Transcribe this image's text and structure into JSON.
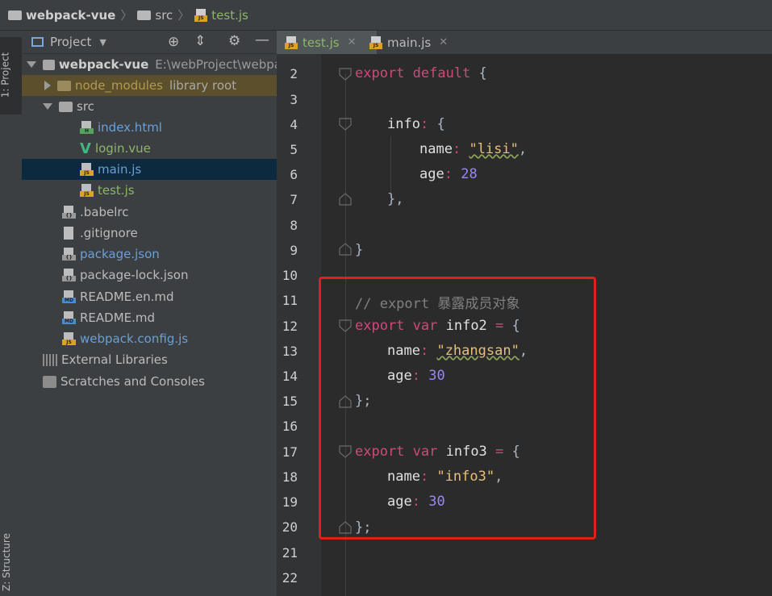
{
  "breadcrumb": {
    "project": "webpack-vue",
    "folder": "src",
    "file": "test.js"
  },
  "sidebar_tabs": {
    "project": "1: Project",
    "structure": "Z: Structure"
  },
  "project_panel": {
    "title": "Project",
    "tree": [
      {
        "label": "webpack-vue",
        "hint": "E:\\webProject\\webpa"
      },
      {
        "label": "node_modules",
        "hint": "library root"
      },
      {
        "label": "src"
      },
      {
        "label": "index.html"
      },
      {
        "label": "login.vue"
      },
      {
        "label": "main.js"
      },
      {
        "label": "test.js"
      },
      {
        "label": ".babelrc"
      },
      {
        "label": ".gitignore"
      },
      {
        "label": "package.json"
      },
      {
        "label": "package-lock.json"
      },
      {
        "label": "README.en.md"
      },
      {
        "label": "README.md"
      },
      {
        "label": "webpack.config.js"
      },
      {
        "label": "External Libraries"
      },
      {
        "label": "Scratches and Consoles"
      }
    ]
  },
  "editor_tabs": [
    {
      "label": "test.js",
      "active": true
    },
    {
      "label": "main.js",
      "active": false
    }
  ],
  "code": {
    "line_numbers": [
      "2",
      "3",
      "4",
      "5",
      "6",
      "7",
      "8",
      "9",
      "10",
      "11",
      "12",
      "13",
      "14",
      "15",
      "16",
      "17",
      "18",
      "19",
      "20",
      "21",
      "22"
    ],
    "export_default": "export default",
    "info_key": "info",
    "name_key": "name",
    "age_key": "age",
    "lisi": "\"lisi\"",
    "age28": "28",
    "comment": "// export 暴露成员对象",
    "export_var": "export var",
    "info2": "info2",
    "zhangsan": "\"zhangsan\"",
    "age30": "30",
    "info3": "info3",
    "info3_str": "\"info3\""
  },
  "colors": {
    "keyword": "#cc4a7a",
    "string": "#e6c07b",
    "number": "#9b87f5",
    "highlight_box": "#e0201a"
  }
}
